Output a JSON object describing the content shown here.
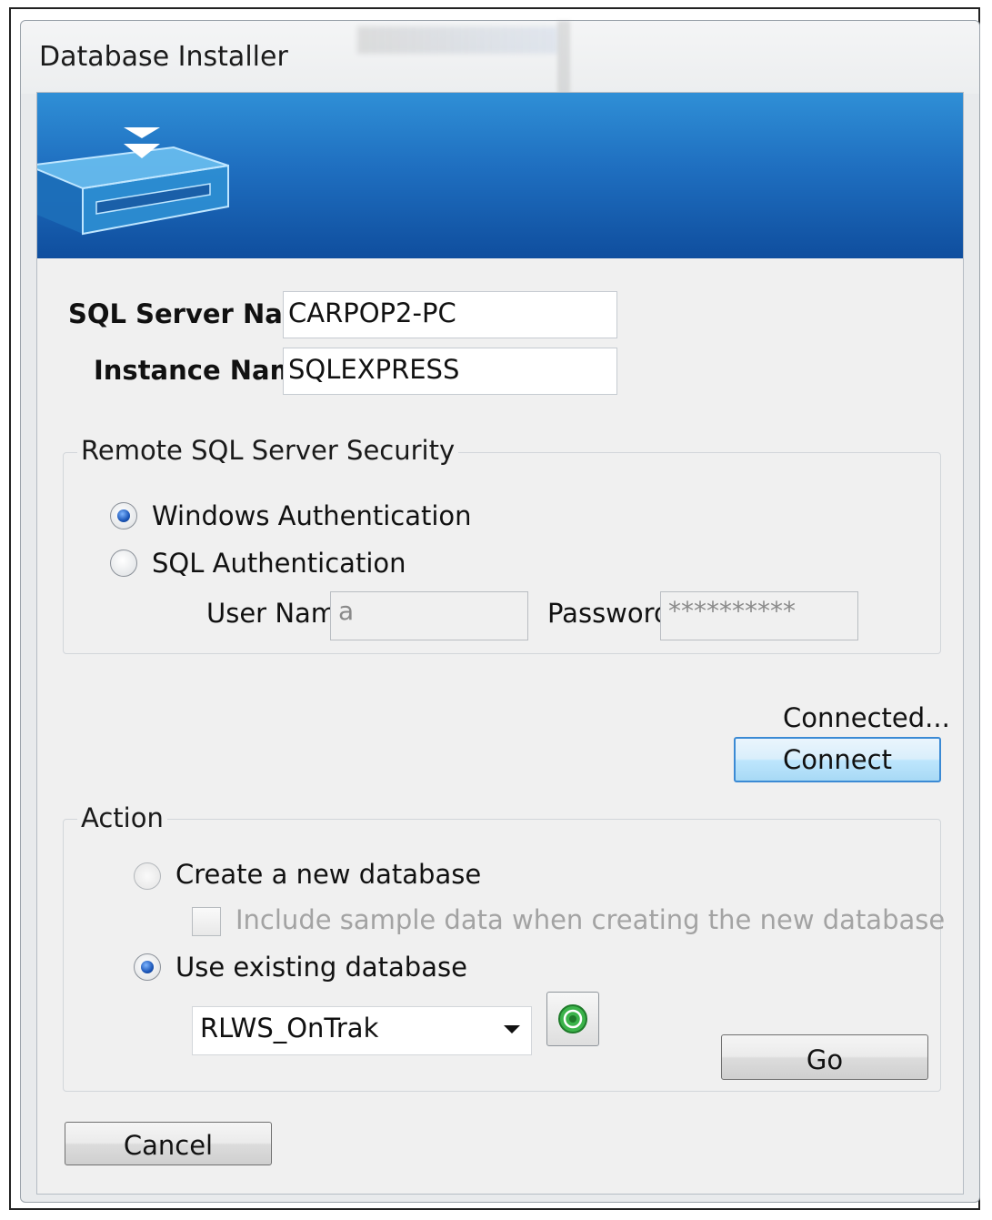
{
  "window": {
    "title": "Database Installer"
  },
  "banner": {
    "icon": "database-install-icon"
  },
  "server": {
    "server_label": "SQL Server Nam",
    "server_value": "CARPOP2-PC",
    "instance_label": "Instance Nam",
    "instance_value": "SQLEXPRESS"
  },
  "security": {
    "title": "Remote SQL Server Security",
    "windows_auth_label": "Windows Authentication",
    "sql_auth_label": "SQL Authentication",
    "selected": "windows",
    "username_label": "User Name",
    "username_value": "a",
    "password_label": "Password",
    "password_value": "**********"
  },
  "connection": {
    "status": "Connected...",
    "connect_label": "Connect"
  },
  "action": {
    "title": "Action",
    "create_label": "Create a new database",
    "include_sample_label": "Include sample data when creating the new database",
    "use_existing_label": "Use existing database",
    "selected": "use_existing",
    "database_value": "RLWS_OnTrak",
    "refresh_icon": "refresh-icon",
    "go_label": "Go"
  },
  "footer": {
    "cancel_label": "Cancel"
  },
  "colors": {
    "banner_top": "#2f8fd6",
    "banner_bottom": "#0f4e9e",
    "focus_border": "#3b8ad4"
  }
}
